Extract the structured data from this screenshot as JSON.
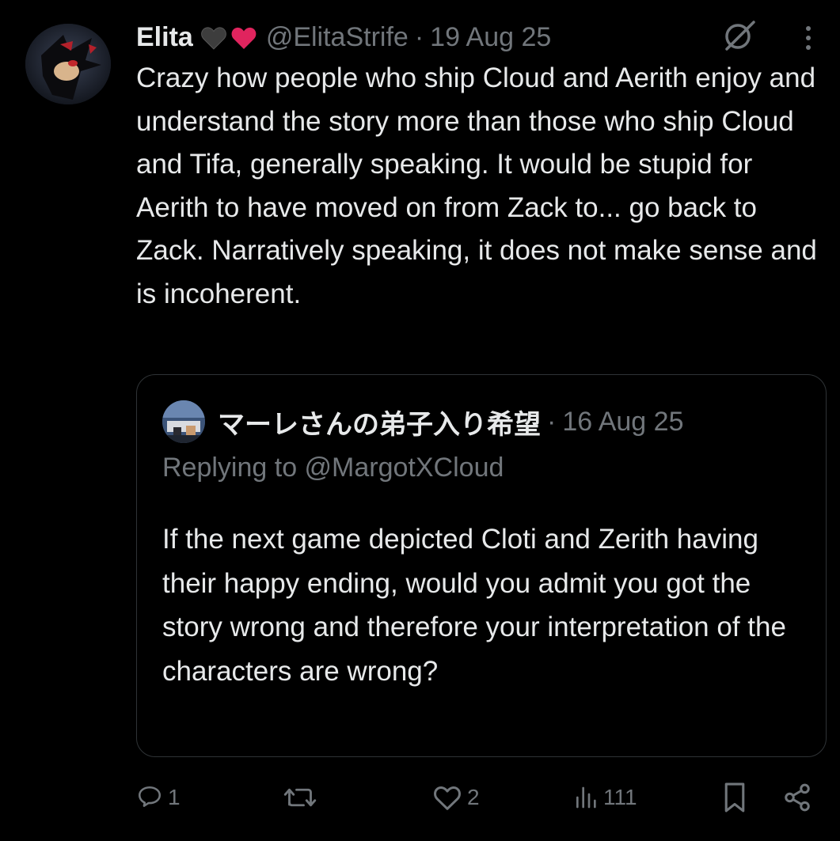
{
  "tweet": {
    "author": {
      "display_name": "Elita",
      "handle": "@ElitaStrife",
      "badges": [
        "black-heart-icon",
        "red-heart-icon"
      ]
    },
    "separator": "·",
    "date": "19 Aug 25",
    "text": "Crazy how people who ship Cloud and Aerith enjoy and understand the story more than those who ship Cloud and Tifa, generally speaking. It would be stupid for Aerith to have moved on from Zack to... go back to Zack. Narratively speaking, it does not make sense and is incoherent."
  },
  "quote": {
    "author_name": "マーレさんの弟子入り希望",
    "separator": "·",
    "date": "16 Aug 25",
    "replying_to": "Replying to @MargotXCloud",
    "text": "If the next game depicted Cloti and Zerith having their happy ending, would you admit you got the story wrong and therefore your interpretation of the characters are wrong?"
  },
  "actions": {
    "replies": "1",
    "reposts": "",
    "likes": "2",
    "views": "111"
  },
  "colors": {
    "background": "#000000",
    "text": "#e7e9ea",
    "muted": "#71767b",
    "border": "#2f3336",
    "heart_red": "#e0245e"
  }
}
